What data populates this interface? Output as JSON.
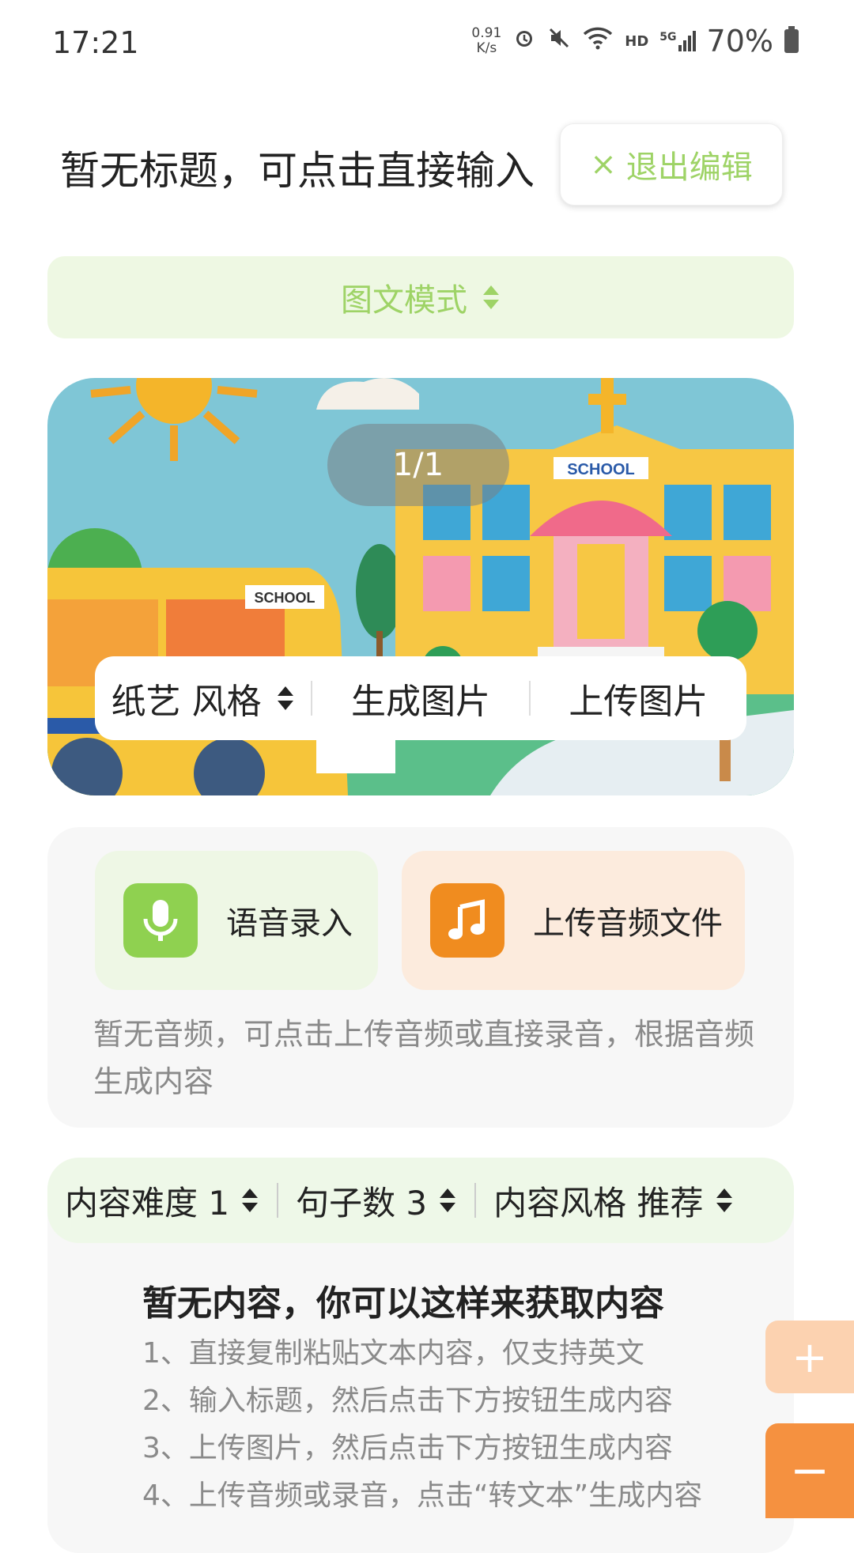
{
  "status_bar": {
    "time": "17:21",
    "net_speed_value": "0.91",
    "net_speed_unit": "K/s",
    "network_label": "HD",
    "signal_label": "5G",
    "battery_pct": "70%"
  },
  "header": {
    "title": "暂无标题，可点击直接输入",
    "exit_label": "退出编辑",
    "exit_icon": "×"
  },
  "mode": {
    "label": "图文模式"
  },
  "image_card": {
    "page_indicator": "1/1",
    "style_label": "纸艺 风格",
    "generate_label": "生成图片",
    "upload_label": "上传图片",
    "school_sign": "SCHOOL",
    "bus_sign": "SCHOOL"
  },
  "audio": {
    "record_label": "语音录入",
    "upload_label": "上传音频文件",
    "hint": "暂无音频，可点击上传音频或直接录音，根据音频生成内容",
    "record_color": "#8fd150",
    "upload_color": "#f08c1f"
  },
  "content": {
    "difficulty_label": "内容难度 1",
    "sentences_label": "句子数 3",
    "style_label": "内容风格 推荐",
    "empty_title": "暂无内容，你可以这样来获取内容",
    "tips": [
      "1、直接复制粘贴文本内容，仅支持英文",
      "2、输入标题，然后点击下方按钮生成内容",
      "3、上传图片，然后点击下方按钮生成内容",
      "4、上传音频或录音，点击“转文本”生成内容"
    ]
  },
  "zoom": {
    "plus": "+",
    "minus": "−"
  },
  "colors": {
    "accent_green": "#9ed366",
    "accent_orange": "#f59140"
  }
}
